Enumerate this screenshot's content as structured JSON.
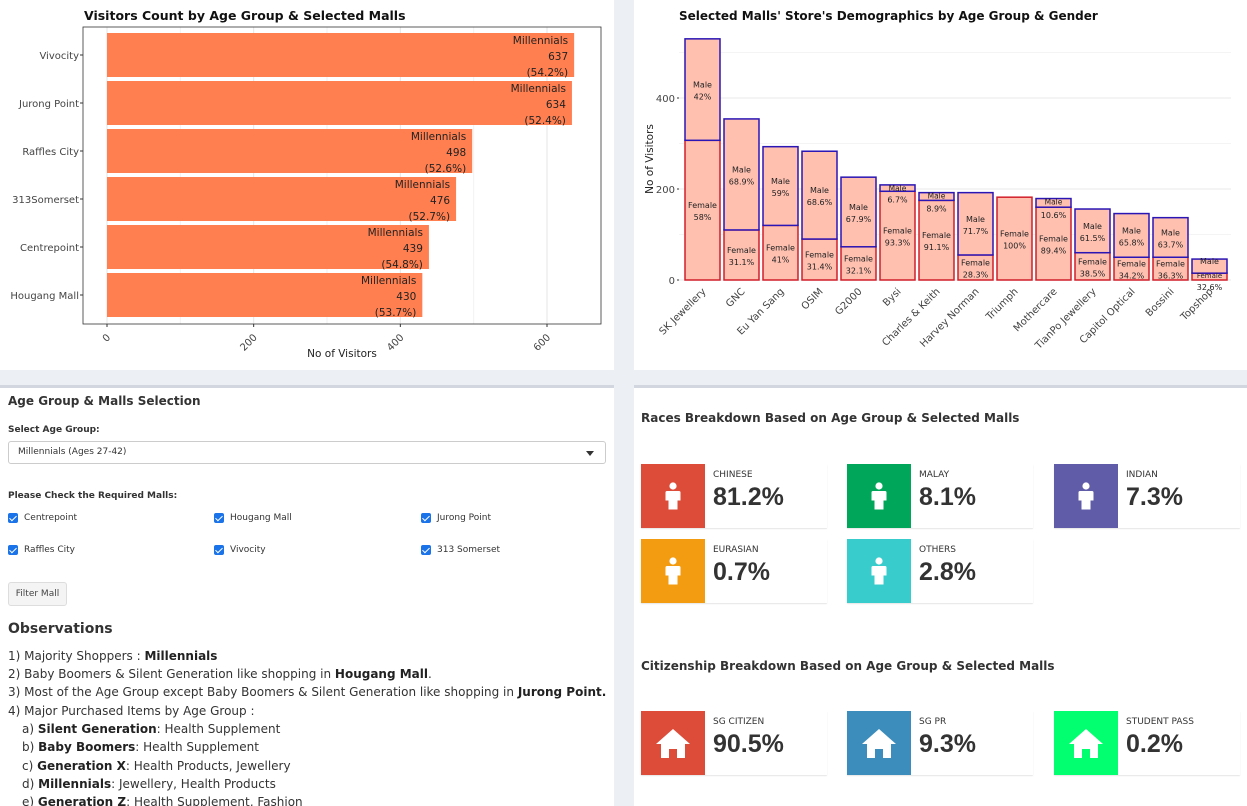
{
  "visitors_chart": {
    "title": "Visitors Count by Age Group & Selected Malls",
    "xlabel": "No of Visitors",
    "bar_color": "#ff7f50"
  },
  "demo_chart": {
    "title": "Selected Malls' Store's Demographics by Age Group & Gender",
    "ylabel": "No of Visitors",
    "fill_color": "#ffc0b0",
    "male_border": "#2a15b5",
    "female_border": "#d11f2b"
  },
  "chart_data": [
    {
      "type": "bar",
      "orientation": "horizontal",
      "title": "Visitors Count by Age Group & Selected Malls",
      "xlabel": "No of Visitors",
      "ylabel": "",
      "xlim": [
        0,
        680
      ],
      "xticks": [
        "0",
        "200",
        "400",
        "600"
      ],
      "grid": true,
      "categories": [
        "Vivocity",
        "Jurong Point",
        "Raffles City",
        "313Somerset",
        "Centrepoint",
        "Hougang Mall"
      ],
      "values": [
        637,
        634,
        498,
        476,
        439,
        430
      ],
      "labels": [
        [
          "Millennials",
          "637",
          "(54.2%)"
        ],
        [
          "Millennials",
          "634",
          "(52.4%)"
        ],
        [
          "Millennials",
          "498",
          "(52.6%)"
        ],
        [
          "Millennials",
          "476",
          "(52.7%)"
        ],
        [
          "Millennials",
          "439",
          "(54.8%)"
        ],
        [
          "Millennials",
          "430",
          "(53.7%)"
        ]
      ]
    },
    {
      "type": "bar",
      "stacked": true,
      "title": "Selected Malls' Store's Demographics by Age Group & Gender",
      "xlabel": "",
      "ylabel": "No of Visitors",
      "ylim": [
        0,
        560
      ],
      "yticks": [
        "0",
        "200",
        "400"
      ],
      "grid": true,
      "categories": [
        "SK Jewellery",
        "GNC",
        "Eu Yan Sang",
        "OSIM",
        "G2000",
        "Bysi",
        "Charles & Keith",
        "Harvey Norman",
        "Triumph",
        "Mothercare",
        "TianPo Jewellery",
        "Capitol Optical",
        "Bossini",
        "Topshop"
      ],
      "series": [
        {
          "name": "Female",
          "values": [
            307,
            110,
            120,
            90,
            73,
            195,
            175,
            55,
            182,
            160,
            60,
            50,
            50,
            15
          ],
          "labels": [
            "58%",
            "31.1%",
            "41%",
            "31.4%",
            "32.1%",
            "93.3%",
            "91.1%",
            "28.3%",
            "100%",
            "89.4%",
            "38.5%",
            "34.2%",
            "36.3%",
            "32.6%"
          ]
        },
        {
          "name": "Male",
          "values": [
            223,
            244,
            173,
            193,
            153,
            14,
            17,
            137,
            0,
            19,
            96,
            96,
            87,
            31
          ],
          "labels": [
            "42%",
            "68.9%",
            "59%",
            "68.6%",
            "67.9%",
            "6.7%",
            "8.9%",
            "71.7%",
            "",
            "10.6%",
            "61.5%",
            "65.8%",
            "63.7%",
            ""
          ]
        }
      ]
    }
  ],
  "selection": {
    "title": "Age Group & Malls Selection",
    "age_label": "Select Age Group:",
    "age_value": "Millennials (Ages 27-42)",
    "malls_label": "Please Check the Required Malls:",
    "malls": [
      "Centrepoint",
      "Hougang Mall",
      "Jurong Point",
      "Raffles City",
      "Vivocity",
      "313 Somerset"
    ],
    "button": "Filter Mall",
    "check_color": "#1a73e8"
  },
  "observations": {
    "title": "Observations",
    "lines": [
      {
        "pre": "1) Majority Shoppers : ",
        "bold": "Millennials",
        "post": ""
      },
      {
        "pre": "2) Baby Boomers & Silent Generation like shopping in ",
        "bold": "Hougang Mall",
        "post": "."
      },
      {
        "pre": "3) Most of the Age Group except Baby Boomers & Silent Generation like shopping in ",
        "bold": "Jurong Point.",
        "post": ""
      },
      {
        "pre": "4) Major Purchased Items by Age Group :",
        "bold": "",
        "post": ""
      },
      {
        "pre": "a) ",
        "bold": "Silent Generation",
        "post": ": Health Supplement"
      },
      {
        "pre": "b) ",
        "bold": "Baby Boomers",
        "post": ": Health Supplement"
      },
      {
        "pre": "c) ",
        "bold": "Generation X",
        "post": ": Health Products, Jewellery"
      },
      {
        "pre": "d) ",
        "bold": "Millennials",
        "post": ": Jewellery, Health Products"
      },
      {
        "pre": "e) ",
        "bold": "Generation Z",
        "post": ": Health Supplement, Fashion"
      }
    ]
  },
  "races": {
    "title": "Races Breakdown Based on Age Group & Selected Malls",
    "items": [
      {
        "label": "CHINESE",
        "value": "81.2%",
        "color": "#dd4b39",
        "icon": "person-icon"
      },
      {
        "label": "MALAY",
        "value": "8.1%",
        "color": "#00a65a",
        "icon": "person-icon"
      },
      {
        "label": "INDIAN",
        "value": "7.3%",
        "color": "#605ca8",
        "icon": "person-icon"
      },
      {
        "label": "EURASIAN",
        "value": "0.7%",
        "color": "#f39c12",
        "icon": "person-icon"
      },
      {
        "label": "OTHERS",
        "value": "2.8%",
        "color": "#39cccc",
        "icon": "person-icon"
      }
    ]
  },
  "citizenship": {
    "title": "Citizenship Breakdown Based on Age Group & Selected Malls",
    "items": [
      {
        "label": "SG CITIZEN",
        "value": "90.5%",
        "color": "#dd4b39",
        "icon": "home-icon"
      },
      {
        "label": "SG PR",
        "value": "9.3%",
        "color": "#3c8dbc",
        "icon": "home-icon"
      },
      {
        "label": "STUDENT PASS",
        "value": "0.2%",
        "color": "#01ff70",
        "icon": "home-icon"
      }
    ]
  }
}
